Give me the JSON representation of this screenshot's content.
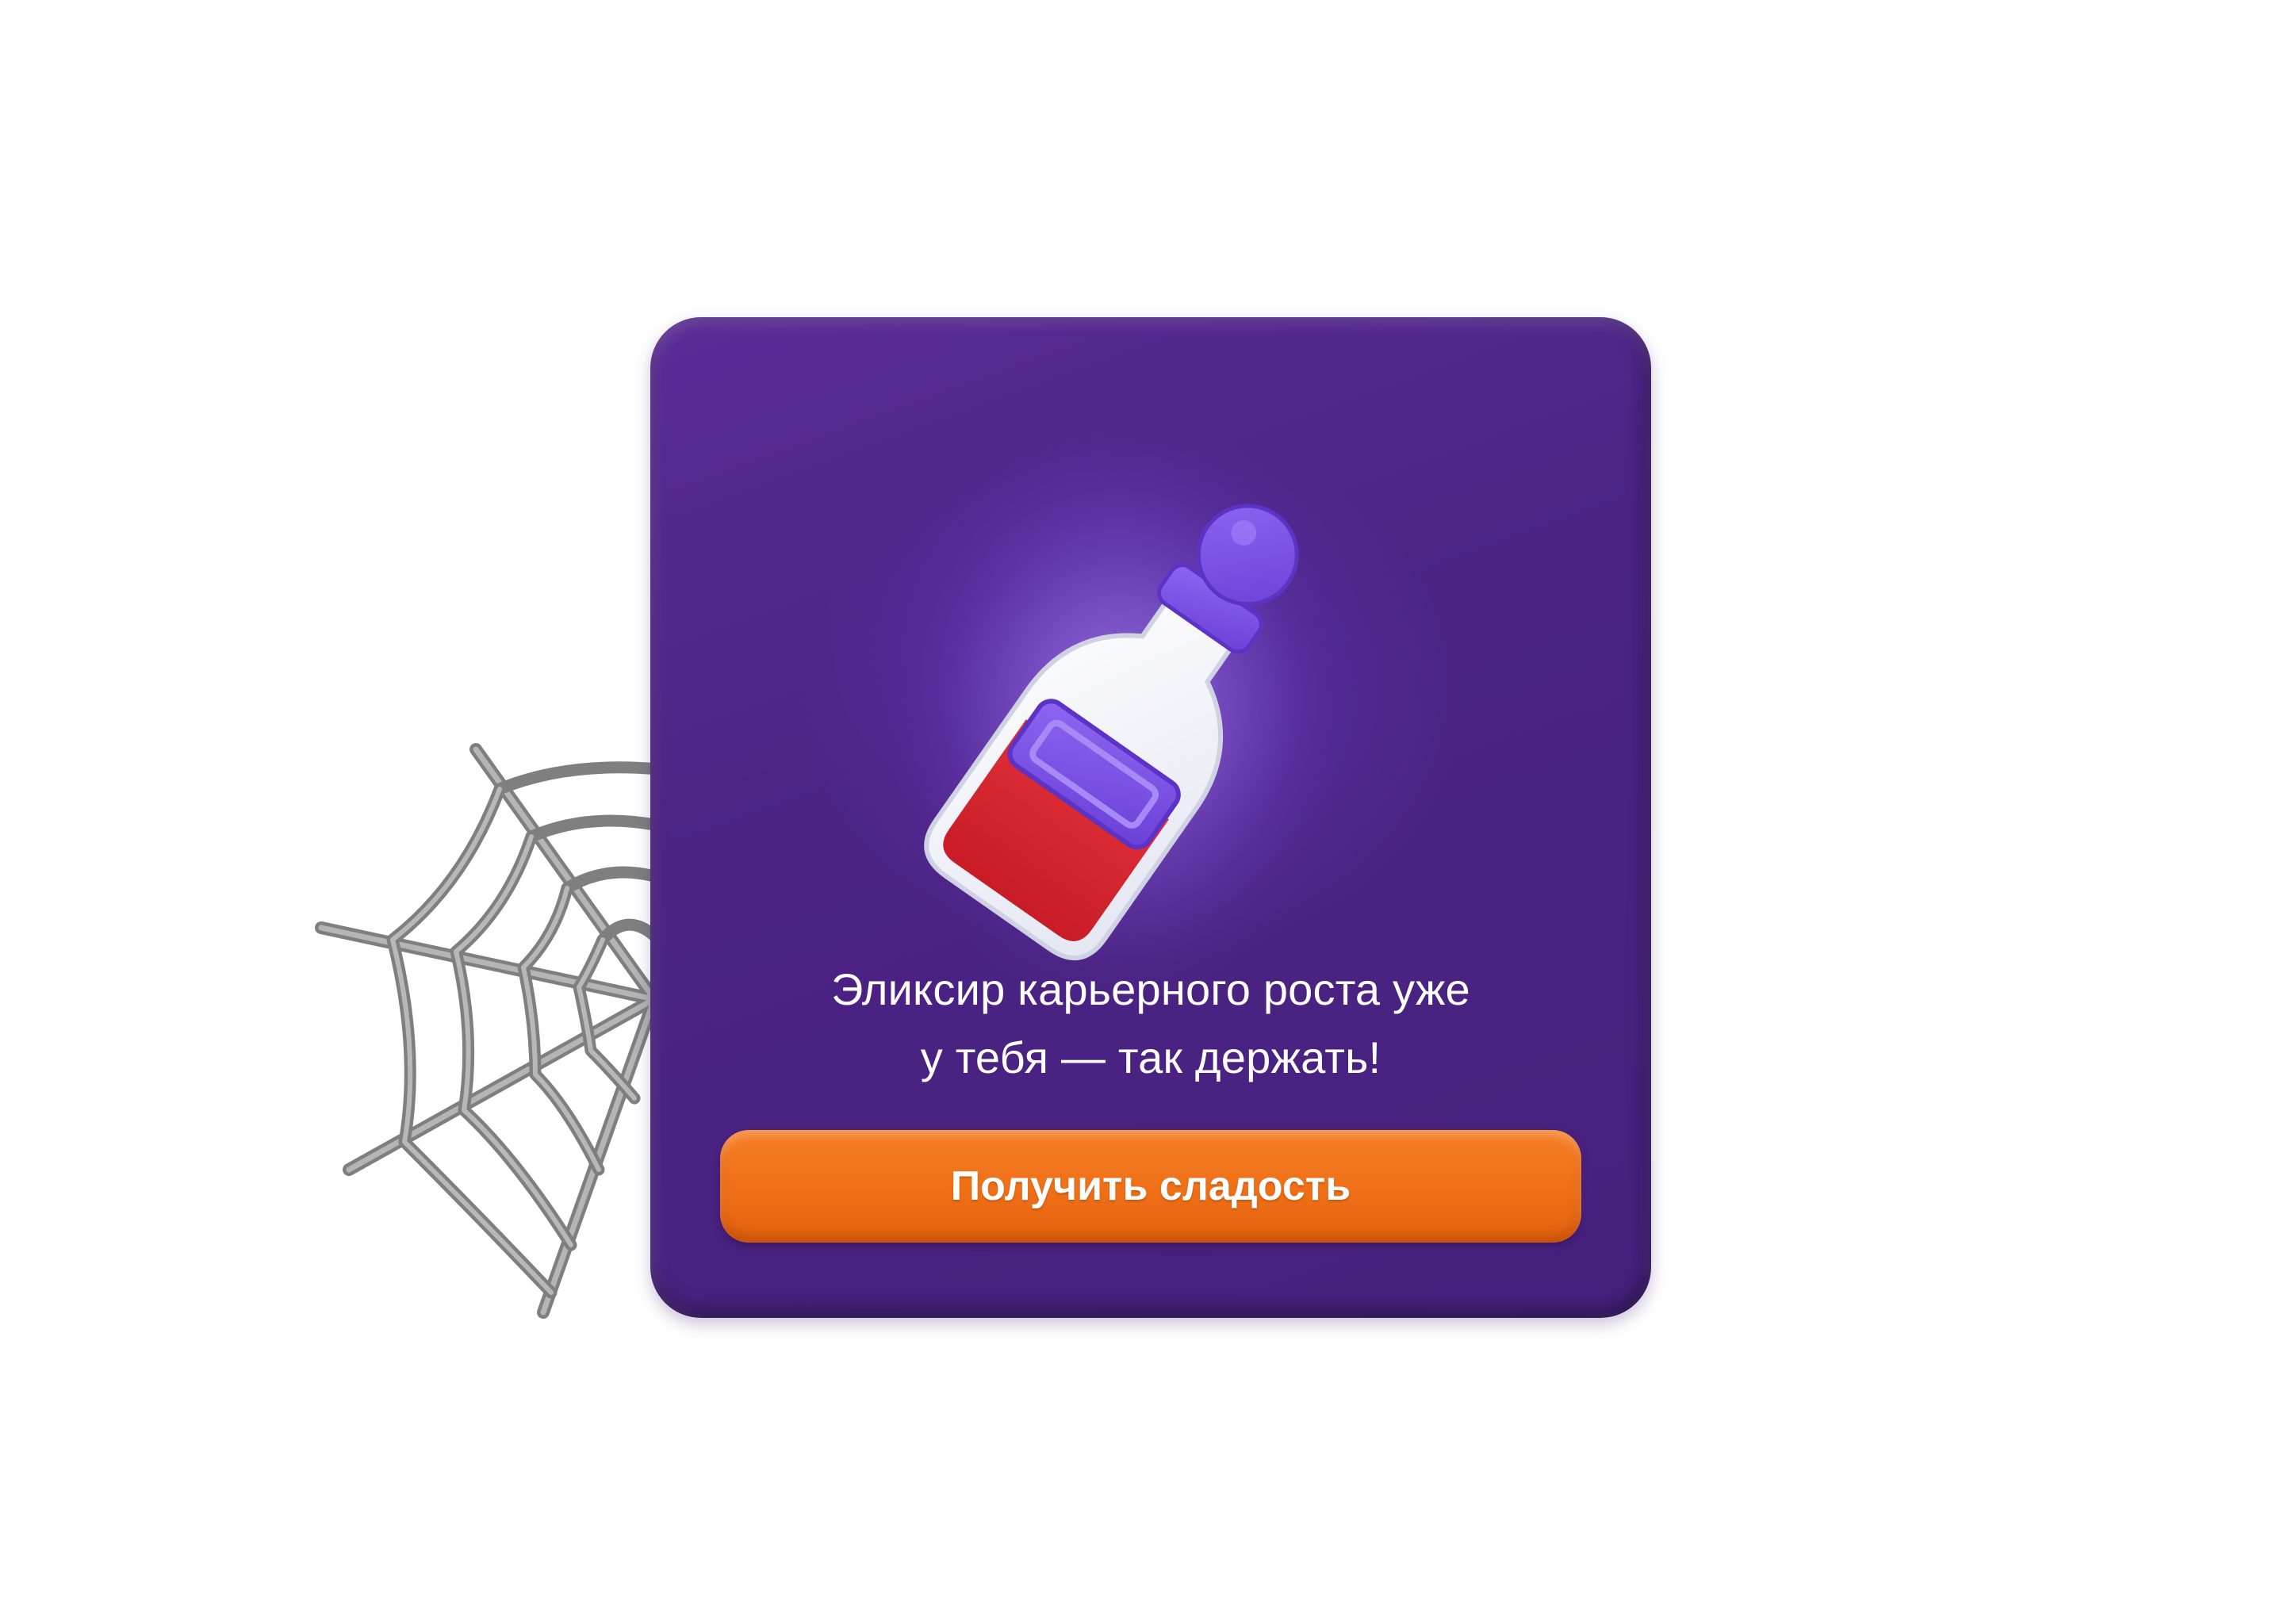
{
  "card": {
    "message_line1": "Эликсир карьерного роста уже",
    "message_line2": "у тебя — так держать!",
    "button_label": "Получить сладость"
  },
  "illustration": {
    "icon": "potion-bottle-icon",
    "decoration": "cobweb-icon"
  },
  "colors": {
    "background": "#ffffff",
    "card": "#4c2385",
    "button": "#ef6f17",
    "potion_liquid": "#d8262e",
    "potion_cap": "#7a4fe0",
    "cobweb": "#8a8a8a"
  }
}
